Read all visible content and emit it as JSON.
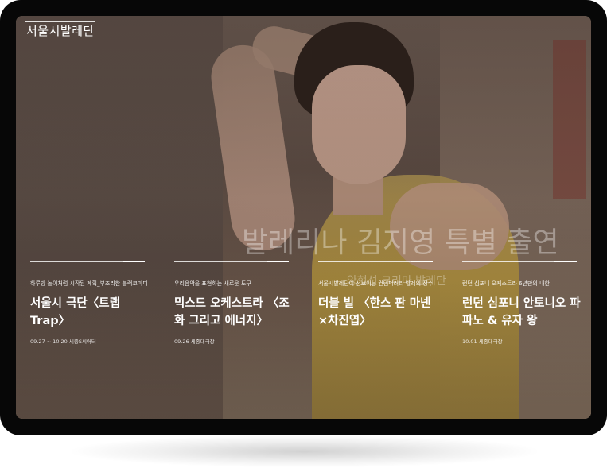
{
  "brand": {
    "logo_text": "서울시발레단"
  },
  "hero": {
    "title": "발레리나 김지영 특별 출연",
    "subtitle": "양현선 크리마 발레단"
  },
  "cards": [
    {
      "description": "하루방 놀이처럼 시작된 계획_부조리한 블랙코미디",
      "title": "서울시 극단〈트랩 Trap〉",
      "meta": "09.27 ~ 10.20 세종S씨어터"
    },
    {
      "description": "우리음악을 표현하는 새로운 도구",
      "title": "믹스드 오케스트라 〈조화 그리고 에너지〉",
      "meta": "09.26 세종대극장"
    },
    {
      "description": "서울시발레단이 선보이는 컨템퍼러리 발레의 정수",
      "title": "더블 빌 〈한스 판 마넨×차진엽〉",
      "meta": ""
    },
    {
      "description": "런던 심포니 오케스트라 6년만의 내한",
      "title": "런던 심포니 안토니오 파파노 & 유자 왕",
      "meta": "10.01 세종대극장"
    }
  ]
}
